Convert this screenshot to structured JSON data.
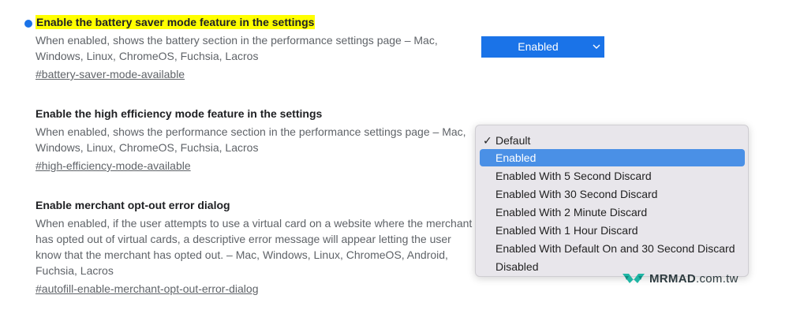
{
  "flags": [
    {
      "title": "Enable the battery saver mode feature in the settings",
      "description": "When enabled, shows the battery section in the performance settings page – Mac, Windows, Linux, ChromeOS, Fuchsia, Lacros",
      "link": "#battery-saver-mode-available"
    },
    {
      "title": "Enable the high efficiency mode feature in the settings",
      "description": "When enabled, shows the performance section in the performance settings page – Mac, Windows, Linux, ChromeOS, Fuchsia, Lacros",
      "link": "#high-efficiency-mode-available"
    },
    {
      "title": "Enable merchant opt-out error dialog",
      "description": "When enabled, if the user attempts to use a virtual card on a website where the merchant has opted out of virtual cards, a descriptive error message will appear letting the user know that the merchant has opted out. – Mac, Windows, Linux, ChromeOS, Android, Fuchsia, Lacros",
      "link": "#autofill-enable-merchant-opt-out-error-dialog"
    }
  ],
  "battery_select": {
    "value": "Enabled"
  },
  "dropdown": {
    "check_mark": "✓",
    "options": [
      "Default",
      "Enabled",
      "Enabled With 5 Second Discard",
      "Enabled With 30 Second Discard",
      "Enabled With 2 Minute Discard",
      "Enabled With 1 Hour Discard",
      "Enabled With Default On and 30 Second Discard",
      "Disabled"
    ],
    "checked_option": "Default",
    "highlighted_option": "Enabled"
  },
  "watermark": {
    "brand": "MRMAD",
    "tld": ".com.tw",
    "logo_icon": "mrmad-logo-icon"
  },
  "colors": {
    "accent": "#1a73e8",
    "highlight": "#ffff00",
    "menu_selection": "#4a90e6",
    "watermark_logo": "#1fb5a4"
  }
}
